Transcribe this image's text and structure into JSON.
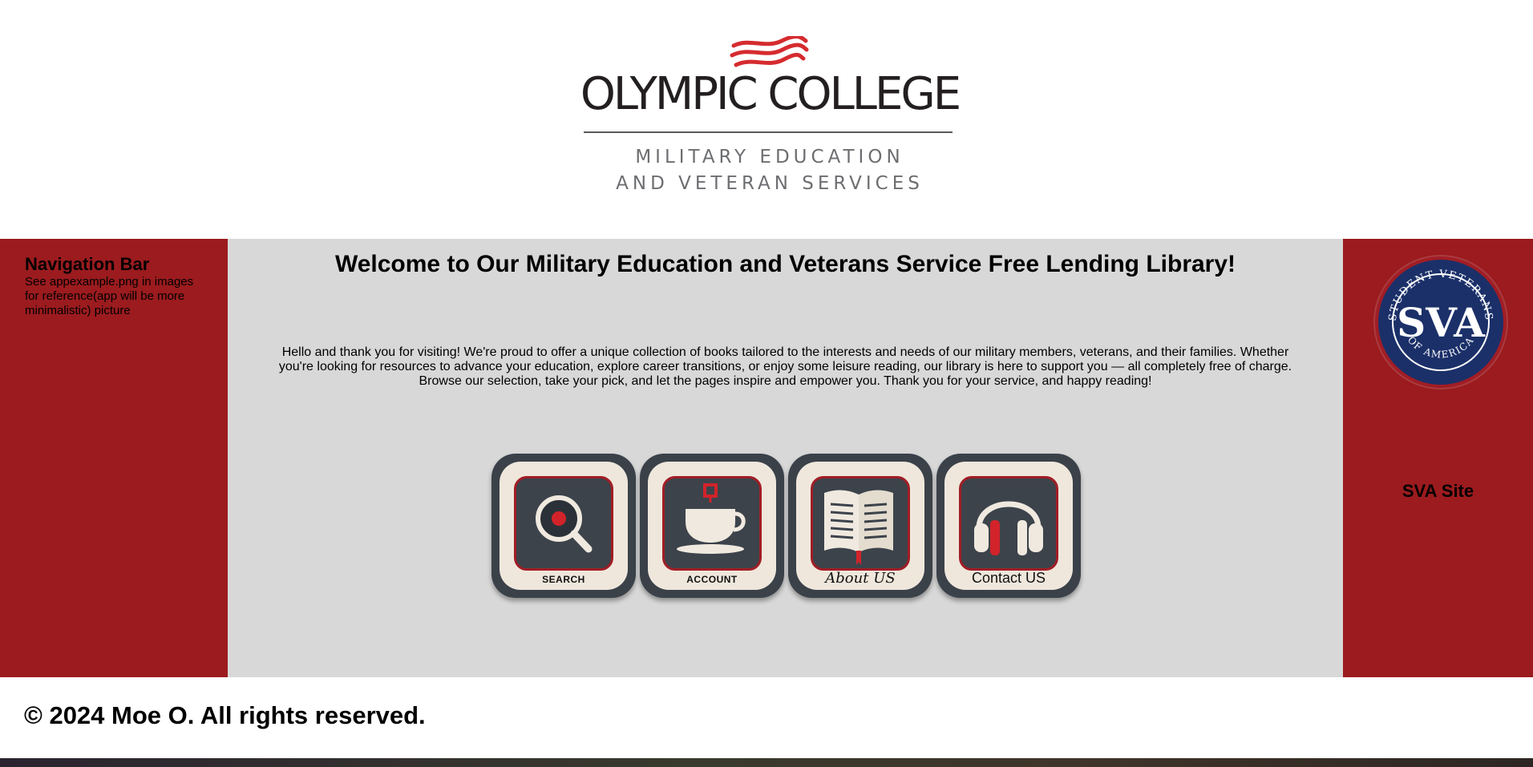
{
  "header": {
    "logo_name": "OLYMPIC COLLEGE",
    "logo_subtitle_line1": "MILITARY EDUCATION",
    "logo_subtitle_line2": "AND VETERAN SERVICES"
  },
  "sidebar_left": {
    "title": "Navigation Bar",
    "description": "See appexample.png in images for reference(app will be more minimalistic) picture"
  },
  "main": {
    "heading": "Welcome to Our Military Education and Veterans Service Free Lending Library!",
    "intro": "Hello and thank you for visiting! We're proud to offer a unique collection of books tailored to the interests and needs of our military members, veterans, and their families. Whether you're looking for resources to advance your education, explore career transitions, or enjoy some leisure reading, our library is here to support you — all completely free of charge. Browse our selection, take your pick, and let the pages inspire and empower you. Thank you for your service, and happy reading!",
    "tiles": [
      {
        "label": "SEARCH",
        "icon": "magnifier-icon"
      },
      {
        "label": "ACCOUNT",
        "icon": "coffee-cup-icon"
      },
      {
        "label": "About US",
        "icon": "open-book-icon"
      },
      {
        "label": "Contact US",
        "icon": "headphones-icon"
      }
    ]
  },
  "sidebar_right": {
    "logo_initials": "SVA",
    "logo_ring_top": "STUDENT VETERANS",
    "logo_ring_bottom": "OF AMERICA",
    "link_label": "SVA Site"
  },
  "footer": {
    "copyright": "© 2024 Moe O. All rights reserved."
  },
  "colors": {
    "brand_red": "#9b1b1e",
    "content_gray": "#d8d8d8",
    "sva_navy": "#1b3069",
    "tile_dark": "#3a4149",
    "tile_cream": "#efe7dc"
  }
}
